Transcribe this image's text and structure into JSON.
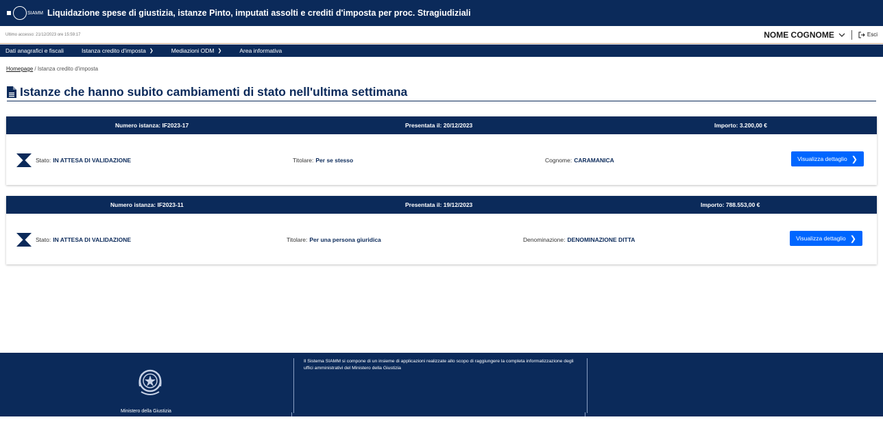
{
  "header": {
    "logo_text": "SIAMM",
    "title": "Liquidazione spese di giustizia, istanze Pinto, imputati assolti e crediti d'imposta per proc. Stragiudiziali"
  },
  "user_bar": {
    "last_access": "Ultimo accesso: 21/12/2023 ore 15:59:17",
    "user_name": "NOME COGNOME",
    "logout_label": "Esci"
  },
  "nav": {
    "items": [
      {
        "label": "Dati anagrafici e fiscali",
        "dropdown": false
      },
      {
        "label": "Istanza credito d'imposta",
        "dropdown": true
      },
      {
        "label": "Mediazioni ODM",
        "dropdown": true
      },
      {
        "label": "Area informativa",
        "dropdown": false
      }
    ]
  },
  "breadcrumb": {
    "home": "Homepage",
    "separator": " / ",
    "current": "Istanza credito d'imposta"
  },
  "page_title": "Istanze che hanno subito cambiamenti di stato nell'ultima settimana",
  "cards": [
    {
      "numero": "Numero istanza: IF2023-17",
      "presentata": "Presentata il: 20/12/2023",
      "importo": "Importo: 3.200,00 €",
      "stato_label": "Stato:",
      "stato_value": "IN ATTESA DI VALIDAZIONE",
      "titolare_label": "Titolare:",
      "titolare_value": "Per se stesso",
      "third_label": "Cognome:",
      "third_value": "CARAMANICA",
      "button_label": "Visualizza dettaglio"
    },
    {
      "numero": "Numero istanza: IF2023-11",
      "presentata": "Presentata il: 19/12/2023",
      "importo": "Importo: 788.553,00 €",
      "stato_label": "Stato:",
      "stato_value": "IN ATTESA DI VALIDAZIONE",
      "titolare_label": "Titolare:",
      "titolare_value": "Per una persona giuridica",
      "third_label": "Denominazione:",
      "third_value": "DENOMINAZIONE DITTA",
      "button_label": "Visualizza dettaglio"
    }
  ],
  "footer": {
    "ministry_1": "Ministero della Giustizia",
    "ministry_2": "Ministero della Giustizia",
    "description": "Il Sistema SIAMM si compone di un insieme di applicazioni realizzate allo scopo di raggiungere la completa informatizzazione degli uffici amministrativi del Ministero della Giustizia"
  },
  "colors": {
    "primary": "#0b2a5a",
    "button": "#0066ff"
  }
}
